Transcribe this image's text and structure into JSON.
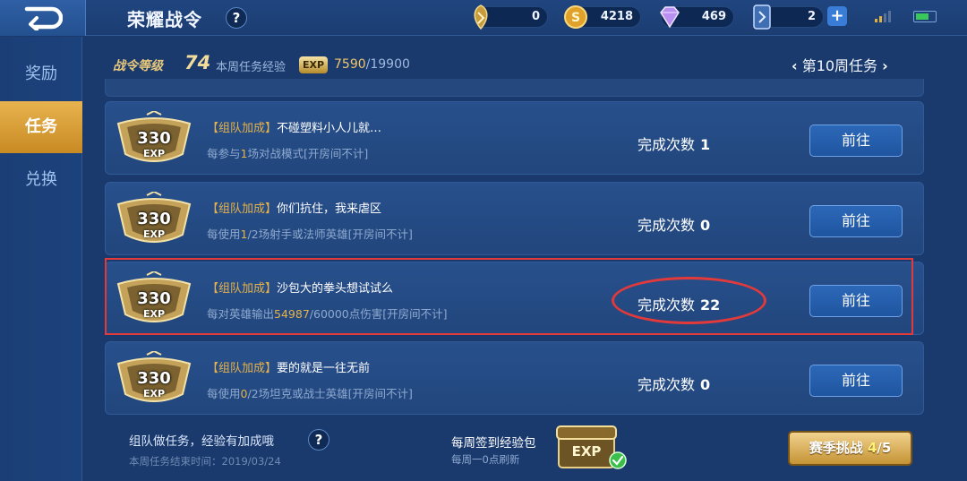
{
  "header": {
    "title": "荣耀战令",
    "help": "?",
    "resources": [
      {
        "name": "token",
        "value": "0"
      },
      {
        "name": "gold",
        "value": "4218"
      },
      {
        "name": "diamond",
        "value": "469"
      },
      {
        "name": "card",
        "value": "2"
      }
    ],
    "add_label": "+"
  },
  "nav": {
    "items": [
      {
        "label": "奖励",
        "active": false
      },
      {
        "label": "任务",
        "active": true
      },
      {
        "label": "兑换",
        "active": false
      }
    ]
  },
  "level": {
    "label": "战令等级",
    "value": "74",
    "weekly_exp_label": "本周任务经验",
    "exp_badge": "EXP",
    "exp_current": "7590",
    "exp_separator": "/",
    "exp_total": "19900"
  },
  "week": {
    "prev": "‹",
    "label": "第10周任务",
    "next": "›"
  },
  "tasks": [
    {
      "reward": "330",
      "reward_unit": "EXP",
      "bonus_tag": "【组队加成】",
      "name": "不碰塑料小人儿就…",
      "desc_pre": "每参与",
      "desc_hl": "1",
      "desc_post": "场对战模式[开房间不计]",
      "count_label": "完成次数",
      "count": "1",
      "button": "前往"
    },
    {
      "reward": "330",
      "reward_unit": "EXP",
      "bonus_tag": "【组队加成】",
      "name": "你们抗住，我来虐区",
      "desc_pre": "每使用",
      "desc_hl": "1",
      "desc_post": "/2场射手或法师英雄[开房间不计]",
      "count_label": "完成次数",
      "count": "0",
      "button": "前往"
    },
    {
      "reward": "330",
      "reward_unit": "EXP",
      "bonus_tag": "【组队加成】",
      "name": "沙包大的拳头想试试么",
      "desc_pre": "每对英雄输出",
      "desc_hl": "54987",
      "desc_post": "/60000点伤害[开房间不计]",
      "count_label": "完成次数",
      "count": "22",
      "button": "前往"
    },
    {
      "reward": "330",
      "reward_unit": "EXP",
      "bonus_tag": "【组队加成】",
      "name": "要的就是一往无前",
      "desc_pre": "每使用",
      "desc_hl": "0",
      "desc_post": "/2场坦克或战士英雄[开房间不计]",
      "count_label": "完成次数",
      "count": "0",
      "button": "前往"
    }
  ],
  "footer": {
    "hint": "组队做任务，经验有加成哦",
    "help": "?",
    "end_time": "本周任务结束时间：2019/03/24",
    "checkin_title": "每周签到经验包",
    "checkin_sub": "每周一0点刷新",
    "chest_label": "EXP",
    "season_label": "赛季挑战",
    "season_current": "4",
    "season_total": "/5"
  },
  "colors": {
    "accent_gold": "#e5b24a",
    "highlight_red": "#e23a3a",
    "panel_blue": "#27508c"
  }
}
